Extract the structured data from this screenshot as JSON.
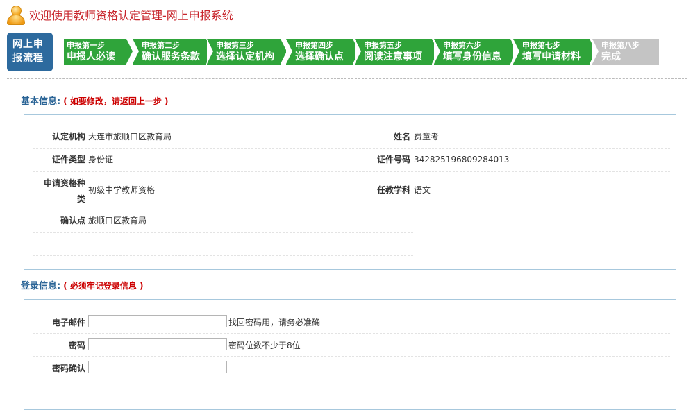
{
  "header": {
    "title": "欢迎使用教师资格认定管理-网上申报系统"
  },
  "flow": {
    "label_line1": "网上申",
    "label_line2": "报流程",
    "steps": [
      {
        "step": "申报第一步",
        "name": "申报人必读"
      },
      {
        "step": "申报第二步",
        "name": "确认服务条款"
      },
      {
        "step": "申报第三步",
        "name": "选择认定机构"
      },
      {
        "step": "申报第四步",
        "name": "选择确认点"
      },
      {
        "step": "申报第五步",
        "name": "阅读注意事项"
      },
      {
        "step": "申报第六步",
        "name": "填写身份信息"
      },
      {
        "step": "申报第七步",
        "name": "填写申请材料"
      },
      {
        "step": "申报第八步",
        "name": "完成"
      }
    ]
  },
  "basic_info": {
    "title": "基本信息:",
    "note": "( 如要修改，请返回上一步 )",
    "fields": {
      "org_label": "认定机构",
      "org_value": "大连市旅顺口区教育局",
      "name_label": "姓名",
      "name_value": "费童考",
      "id_type_label": "证件类型",
      "id_type_value": "身份证",
      "id_no_label": "证件号码",
      "id_no_value": "342825196809284013",
      "cert_type_label_1": "申请资格种",
      "cert_type_label_2": "类",
      "cert_type_value": "初级中学教师资格",
      "subject_label": "任教学科",
      "subject_value": "语文",
      "confirm_label": "确认点",
      "confirm_value": "旅顺口区教育局"
    }
  },
  "login_info": {
    "title": "登录信息:",
    "note": "( 必须牢记登录信息 )",
    "email_label": "电子邮件",
    "email_value": "",
    "email_hint": "找回密码用，请务必准确",
    "password_label": "密码",
    "password_value": "",
    "password_hint": "密码位数不少于8位",
    "confirm_label": "密码确认",
    "confirm_value": ""
  },
  "colors": {
    "step_done": "#2fa43a",
    "step_pending": "#c4c4c4",
    "flow_label": "#2d6a9e",
    "title_red": "#c8252c",
    "section_blue": "#2a6496"
  }
}
